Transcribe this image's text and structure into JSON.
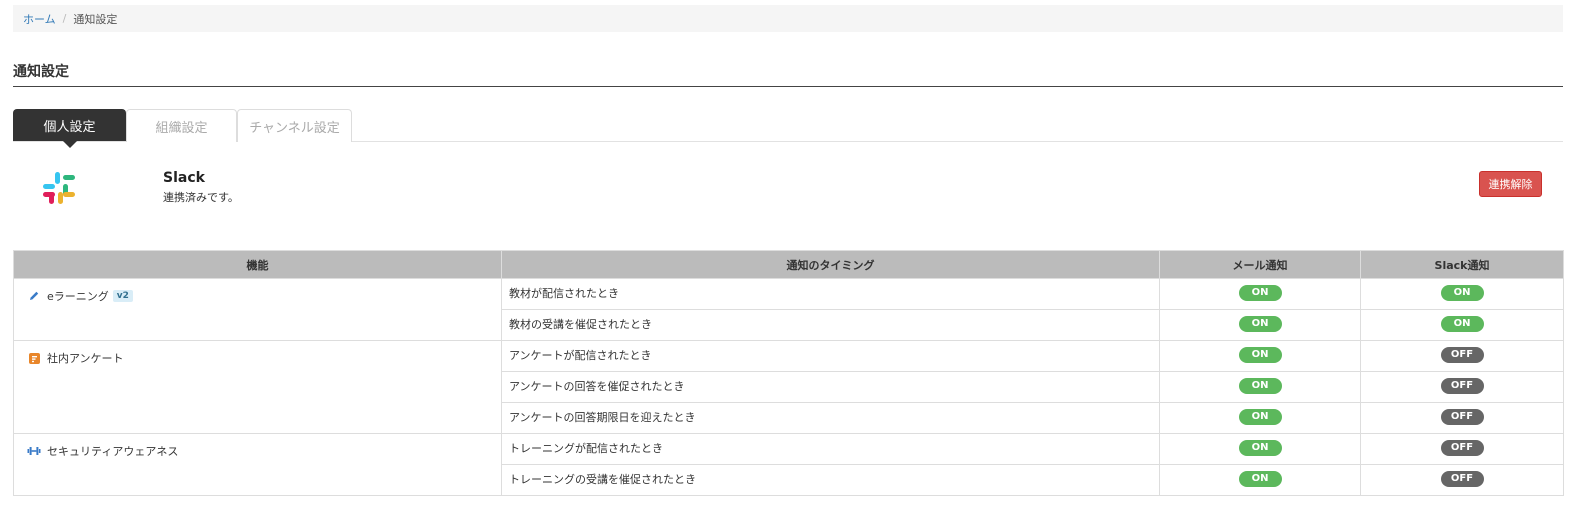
{
  "breadcrumb": {
    "home": "ホーム",
    "separator": "/",
    "current": "通知設定"
  },
  "page_title": "通知設定",
  "tabs": [
    {
      "label": "個人設定",
      "active": true
    },
    {
      "label": "組織設定",
      "active": false
    },
    {
      "label": "チャンネル設定",
      "active": false
    }
  ],
  "slack": {
    "name": "Slack",
    "status": "連携済みです。",
    "unlink_label": "連携解除",
    "logo_icon": "slack-logo"
  },
  "table": {
    "headers": [
      "機能",
      "通知のタイミング",
      "メール通知",
      "Slack通知"
    ],
    "groups": [
      {
        "feature": "eラーニング",
        "badge": "v2",
        "icon": "pencil-icon",
        "rows": [
          {
            "timing": "教材が配信されたとき",
            "mail": "ON",
            "slack": "ON"
          },
          {
            "timing": "教材の受講を催促されたとき",
            "mail": "ON",
            "slack": "ON"
          }
        ]
      },
      {
        "feature": "社内アンケート",
        "badge": "",
        "icon": "survey-icon",
        "rows": [
          {
            "timing": "アンケートが配信されたとき",
            "mail": "ON",
            "slack": "OFF"
          },
          {
            "timing": "アンケートの回答を催促されたとき",
            "mail": "ON",
            "slack": "OFF"
          },
          {
            "timing": "アンケートの回答期限日を迎えたとき",
            "mail": "ON",
            "slack": "OFF"
          }
        ]
      },
      {
        "feature": "セキュリティアウェアネス",
        "badge": "",
        "icon": "dumbbell-icon",
        "rows": [
          {
            "timing": "トレーニングが配信されたとき",
            "mail": "ON",
            "slack": "OFF"
          },
          {
            "timing": "トレーニングの受講を催促されたとき",
            "mail": "ON",
            "slack": "OFF"
          }
        ]
      }
    ]
  },
  "colors": {
    "on": "#5cb85c",
    "off": "#666666",
    "danger": "#d9534f",
    "active_tab": "#333333",
    "link": "#337ab7"
  }
}
